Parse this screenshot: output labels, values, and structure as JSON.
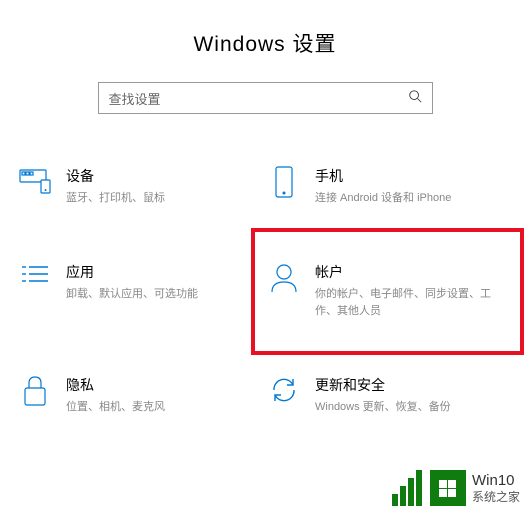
{
  "header": {
    "title": "Windows 设置"
  },
  "search": {
    "placeholder": "查找设置"
  },
  "tiles": {
    "devices": {
      "title": "设备",
      "desc": "蓝牙、打印机、鼠标"
    },
    "phone": {
      "title": "手机",
      "desc": "连接 Android 设备和 iPhone"
    },
    "apps": {
      "title": "应用",
      "desc": "卸载、默认应用、可选功能"
    },
    "accounts": {
      "title": "帐户",
      "desc": "你的帐户、电子邮件、同步设置、工作、其他人员"
    },
    "privacy": {
      "title": "隐私",
      "desc": "位置、相机、麦克风"
    },
    "update": {
      "title": "更新和安全",
      "desc": "Windows 更新、恢复、备份"
    }
  },
  "watermark": {
    "brand": "Win10",
    "sub": "系统之家"
  }
}
